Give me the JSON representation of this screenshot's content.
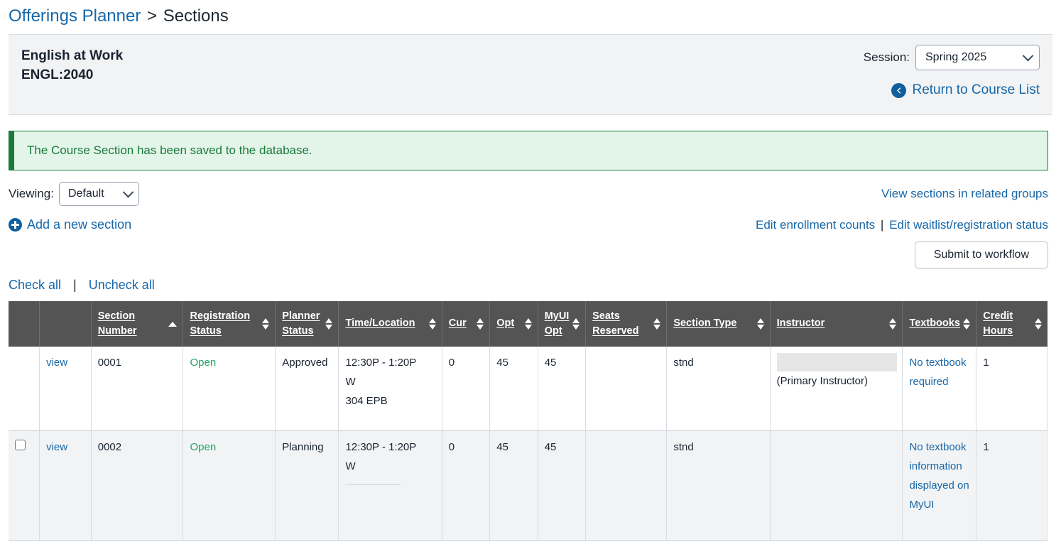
{
  "breadcrumb": {
    "root": "Offerings Planner",
    "separator": ">",
    "current": "Sections"
  },
  "course_header": {
    "title": "English at Work",
    "code": "ENGL:2040",
    "session_label": "Session:",
    "session_value": "Spring 2025",
    "return_link": "Return to Course List"
  },
  "banner": {
    "message": "The Course Section has been saved to the database.",
    "accent_color": "#1a7a3c",
    "background_color": "#e3f4e8"
  },
  "viewing": {
    "label": "Viewing:",
    "value": "Default",
    "related_groups_link": "View sections in related groups"
  },
  "actions": {
    "add_section": "Add a new section",
    "edit_enrollment": "Edit enrollment counts",
    "pipe": "|",
    "edit_waitlist": "Edit waitlist/registration status",
    "submit_workflow": "Submit to workflow",
    "check_all": "Check all",
    "uncheck_all": "Uncheck all"
  },
  "table": {
    "columns": [
      {
        "label": "",
        "sort": "none"
      },
      {
        "label": "",
        "sort": "none"
      },
      {
        "label": "Section Number",
        "sort": "asc"
      },
      {
        "label": "Registration Status",
        "sort": "both"
      },
      {
        "label": "Planner Status",
        "sort": "both"
      },
      {
        "label": "Time/Location",
        "sort": "both"
      },
      {
        "label": "Cur",
        "sort": "both"
      },
      {
        "label": "Opt",
        "sort": "both"
      },
      {
        "label": "MyUI Opt",
        "sort": "both"
      },
      {
        "label": "Seats Reserved",
        "sort": "both"
      },
      {
        "label": "Section Type",
        "sort": "both"
      },
      {
        "label": "Instructor",
        "sort": "both"
      },
      {
        "label": "Textbooks",
        "sort": "both"
      },
      {
        "label": "Credit Hours",
        "sort": "both"
      }
    ],
    "rows": [
      {
        "has_checkbox": false,
        "checked": false,
        "view": "view",
        "section_number": "0001",
        "registration_status": "Open",
        "planner_status": "Approved",
        "time": "12:30P - 1:20P",
        "days": "W",
        "location": "304 EPB",
        "cur": "0",
        "opt": "45",
        "myui_opt": "45",
        "seats_reserved": "",
        "section_type": "stnd",
        "instructor_redacted": true,
        "instructor_role": "(Primary Instructor)",
        "textbooks": "No textbook required",
        "credit_hours": "1"
      },
      {
        "has_checkbox": true,
        "checked": false,
        "view": "view",
        "section_number": "0002",
        "registration_status": "Open",
        "planner_status": "Planning",
        "time": "12:30P - 1:20P",
        "days": "W",
        "location": "",
        "cur": "0",
        "opt": "45",
        "myui_opt": "45",
        "seats_reserved": "",
        "section_type": "stnd",
        "instructor_redacted": false,
        "instructor_role": "",
        "textbooks": "No textbook information displayed on MyUI",
        "credit_hours": "1"
      }
    ]
  },
  "colors": {
    "link": "#1767a8",
    "header_bg": "#545454",
    "open_status": "#1fa463"
  }
}
